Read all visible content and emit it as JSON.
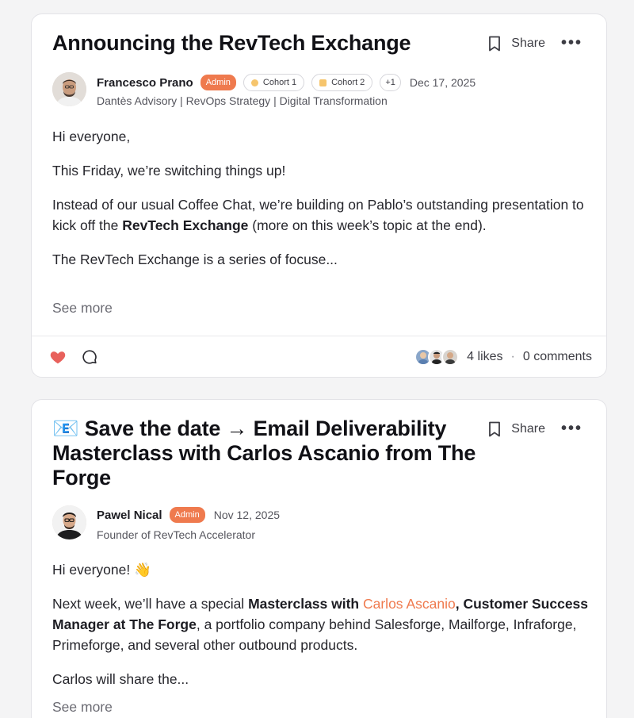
{
  "posts": [
    {
      "title": "Announcing the RevTech Exchange",
      "share_label": "Share",
      "more_label": "•••",
      "author": {
        "name": "Francesco Prano",
        "badge": "Admin",
        "subtitle": "Dantès Advisory | RevOps Strategy | Digital Transformation"
      },
      "pills": [
        "Cohort 1",
        "Cohort 2",
        "+1"
      ],
      "date": "Dec 17, 2025",
      "body": {
        "p1": "Hi everyone,",
        "p2": "This Friday, we’re switching things up!",
        "p3_pre": "Instead of our usual Coffee Chat, we’re building on Pablo’s outstanding presentation to kick off the ",
        "p3_bold": "RevTech Exchange",
        "p3_post": " (more on this week’s topic at the end).",
        "p4": "The RevTech Exchange is a series of focuse..."
      },
      "see_more": "See more",
      "likes": "4 likes",
      "separator": "·",
      "comments": "0 comments"
    },
    {
      "title_emoji": "📧",
      "title": "Save the date → Email Deliverability Masterclass with Carlos Ascanio from The Forge",
      "share_label": "Share",
      "more_label": "•••",
      "author": {
        "name": "Pawel Nical",
        "badge": "Admin",
        "subtitle": "Founder of RevTech Accelerator"
      },
      "date": "Nov 12, 2025",
      "body": {
        "p1": "Hi everyone! 👋",
        "p2_pre": "Next week, we’ll have a special ",
        "p2_bold1": "Masterclass with ",
        "p2_accent": "Carlos Ascanio",
        "p2_bold2": ", Customer Success Manager at The Forge",
        "p2_post": ", a portfolio company behind Salesforge, Mailforge, Infraforge, Primeforge, and several other outbound products.",
        "p3": "Carlos will share the..."
      },
      "see_more": "See more"
    }
  ],
  "colors": {
    "accent": "#ef7a4e",
    "heart": "#e8615c",
    "cohort_dot": "#f6c56d"
  }
}
